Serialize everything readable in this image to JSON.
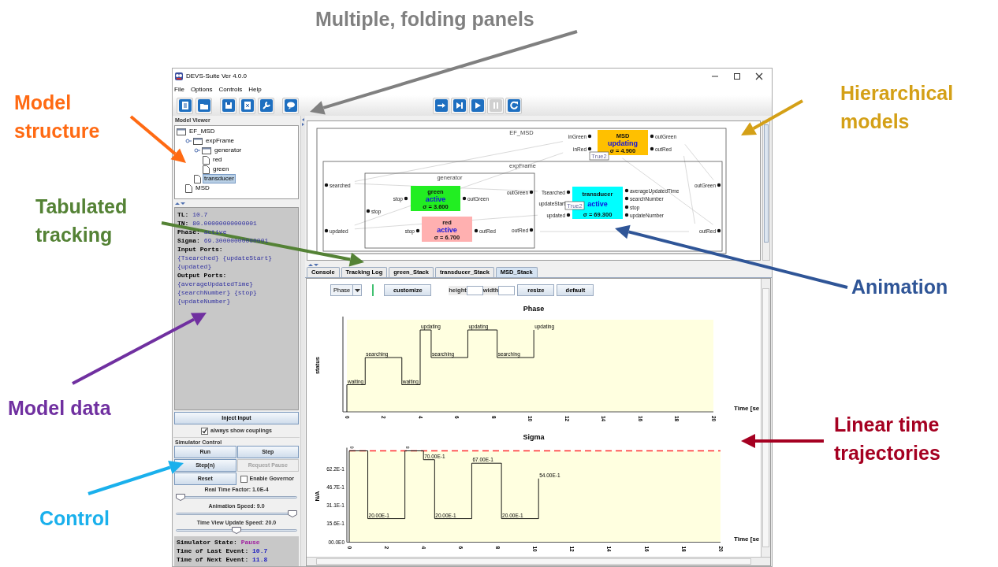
{
  "annotations": [
    {
      "text": "Multiple, folding panels",
      "color": "#808080"
    },
    {
      "text": "Model structure",
      "color": "#ff6a13"
    },
    {
      "text": "Tabulated tracking",
      "color": "#548235"
    },
    {
      "text": "Model data",
      "color": "#7030a0"
    },
    {
      "text": "Control",
      "color": "#1ab0ec"
    },
    {
      "text": "Hierarchical models",
      "color": "#d4a017"
    },
    {
      "text": "Animation",
      "color": "#2f5597"
    },
    {
      "text": "Linear time trajectories",
      "color": "#a50021"
    }
  ],
  "window": {
    "title": "DEVS-Suite Ver 4.0.0"
  },
  "menu": [
    "File",
    "Options",
    "Controls",
    "Help"
  ],
  "toolbar_left": [
    {
      "kind": "document",
      "disabled": false
    },
    {
      "kind": "folder",
      "disabled": false
    },
    {
      "kind": "save",
      "disabled": false
    },
    {
      "kind": "export",
      "disabled": false
    },
    {
      "kind": "wrench",
      "disabled": false
    },
    {
      "kind": "chat",
      "disabled": false
    }
  ],
  "toolbar_right": [
    {
      "kind": "step-in",
      "disabled": false
    },
    {
      "kind": "step",
      "disabled": false
    },
    {
      "kind": "run",
      "disabled": false
    },
    {
      "kind": "pause",
      "disabled": true
    },
    {
      "kind": "reset",
      "disabled": false
    }
  ],
  "model_viewer": {
    "title": "Model Viewer",
    "tree": [
      {
        "label": "EF_MSD",
        "kind": "folder",
        "selected": false,
        "children": [
          {
            "label": "expFrame",
            "kind": "folder",
            "selected": false,
            "expanded": true,
            "children": [
              {
                "label": "generator",
                "kind": "folder",
                "selected": false,
                "expanded": true,
                "children": [
                  {
                    "label": "red",
                    "kind": "leaf",
                    "selected": false
                  },
                  {
                    "label": "green",
                    "kind": "leaf",
                    "selected": false
                  }
                ]
              },
              {
                "label": "transducer",
                "kind": "leaf",
                "selected": true
              }
            ]
          },
          {
            "label": "MSD",
            "kind": "leaf",
            "selected": false
          }
        ]
      }
    ]
  },
  "model_data": [
    {
      "label": "TL:",
      "value": "10.7"
    },
    {
      "label": "TN:",
      "value": "80.00000000000001"
    },
    {
      "label": "Phase:",
      "value": "active"
    },
    {
      "label": "Sigma:",
      "value": "69.30000000000001"
    },
    {
      "label": "Input Ports:"
    },
    {
      "value": "{Tsearched} {updateStart}"
    },
    {
      "value": "{updated}"
    },
    {
      "label": "Output Ports:"
    },
    {
      "value": "{averageUpdatedTime}"
    },
    {
      "value": "{searchNumber} {stop}"
    },
    {
      "value": "{updateNumber}"
    }
  ],
  "inject_button": "Inject Input",
  "couplings": {
    "label": "always show couplings",
    "checked": true
  },
  "simulator_control": {
    "title": "Simulator Control",
    "buttons": [
      {
        "label": "Run",
        "disabled": false
      },
      {
        "label": "Step",
        "disabled": false
      },
      {
        "label": "Step(n)",
        "disabled": false
      },
      {
        "label": "Request Pause",
        "disabled": true
      },
      {
        "label": "Reset",
        "disabled": false
      }
    ],
    "governor": {
      "label": "Enable Governor",
      "checked": false
    },
    "sliders": [
      {
        "label": "Real Time Factor: 1.0E-4",
        "level": 0
      },
      {
        "label": "Animation Speed: 9.0",
        "level": 1
      },
      {
        "label": "Time View Update Speed: 20.0",
        "level": 0.5
      }
    ]
  },
  "status": [
    {
      "label": "Simulator State:",
      "value": "Pause",
      "color": "#a020a0"
    },
    {
      "label": "Time of Last Event:",
      "value": "10.7",
      "color": "#2020c0"
    },
    {
      "label": "Time of Next Event:",
      "value": "11.8",
      "color": "#2020c0"
    }
  ],
  "diagram": {
    "models": [
      {
        "name": "EF_MSD",
        "kind": "coupled"
      },
      {
        "name": "MSD",
        "kind": "atomic",
        "phase": "updating",
        "sigma": "σ = 4.900",
        "color": "#ffc000",
        "in_ports": [
          "inGreen",
          "inRed"
        ],
        "out_ports": [
          "outGreen",
          "outRed"
        ]
      },
      {
        "name": "expFrame",
        "kind": "coupled",
        "in_ports": [
          "searched",
          "updated"
        ],
        "out_ports": [
          "outGreen",
          "outRed"
        ]
      },
      {
        "name": "generator",
        "kind": "coupled",
        "in_ports": [
          "stop"
        ],
        "out_ports": [
          "outGreen",
          "outRed"
        ]
      },
      {
        "name": "green",
        "kind": "atomic",
        "phase": "active",
        "sigma": "σ = 3.600",
        "color": "#22ee22",
        "in_ports": [
          "stop"
        ],
        "out_ports": [
          "outGreen"
        ]
      },
      {
        "name": "red",
        "kind": "atomic",
        "phase": "active",
        "sigma": "σ = 6.700",
        "color": "#ffb0b0",
        "in_ports": [
          "stop"
        ],
        "out_ports": [
          "outRed"
        ]
      },
      {
        "name": "transducer",
        "kind": "atomic",
        "phase": "active",
        "sigma": "σ = 69.300",
        "color": "#00ffff",
        "in_ports": [
          "Tsearched",
          "updateStart",
          "updated"
        ],
        "out_ports": [
          "averageUpdatedTime",
          "searchNumber",
          "stop",
          "updateNumber"
        ]
      }
    ],
    "labels": [
      "True2",
      "True2"
    ]
  },
  "tabs": [
    {
      "label": "Console",
      "selected": false
    },
    {
      "label": "Tracking Log",
      "selected": false
    },
    {
      "label": "green_Stack",
      "selected": false
    },
    {
      "label": "transducer_Stack",
      "selected": false
    },
    {
      "label": "MSD_Stack",
      "selected": true
    }
  ],
  "chart_toolbar": {
    "dropdown": "Phase",
    "customize": "customize",
    "fields": [
      {
        "label": "height"
      },
      {
        "label": "width"
      }
    ],
    "buttons": [
      "resize",
      "default"
    ]
  },
  "phase_plot": {
    "title": "Phase",
    "xlabel": "Time [se",
    "ylabel": "status",
    "tick_labels": [
      "0",
      "2",
      "4",
      "6",
      "8",
      "10",
      "12",
      "14",
      "16",
      "18",
      "20"
    ],
    "state_labels": [
      "waiting",
      "searching",
      "waiting",
      "updating",
      "searching",
      "updating",
      "searching",
      "updating"
    ]
  },
  "sigma_plot": {
    "title": "Sigma",
    "xlabel": "Time [se",
    "ylabel": "N/A",
    "tick_labels": [
      "0",
      "2",
      "4",
      "6",
      "8",
      "10",
      "12",
      "14",
      "16",
      "18",
      "20"
    ],
    "y_tick_labels": [
      "62.2E-1",
      "46.7E-1",
      "31.1E-1",
      "15.6E-1",
      "00.0E0"
    ],
    "value_labels": [
      "∞",
      "20.00E-1",
      "∞",
      "70.00E-1",
      "20.00E-1",
      "67.00E-1",
      "20.00E-1",
      "54.00E-1"
    ]
  }
}
